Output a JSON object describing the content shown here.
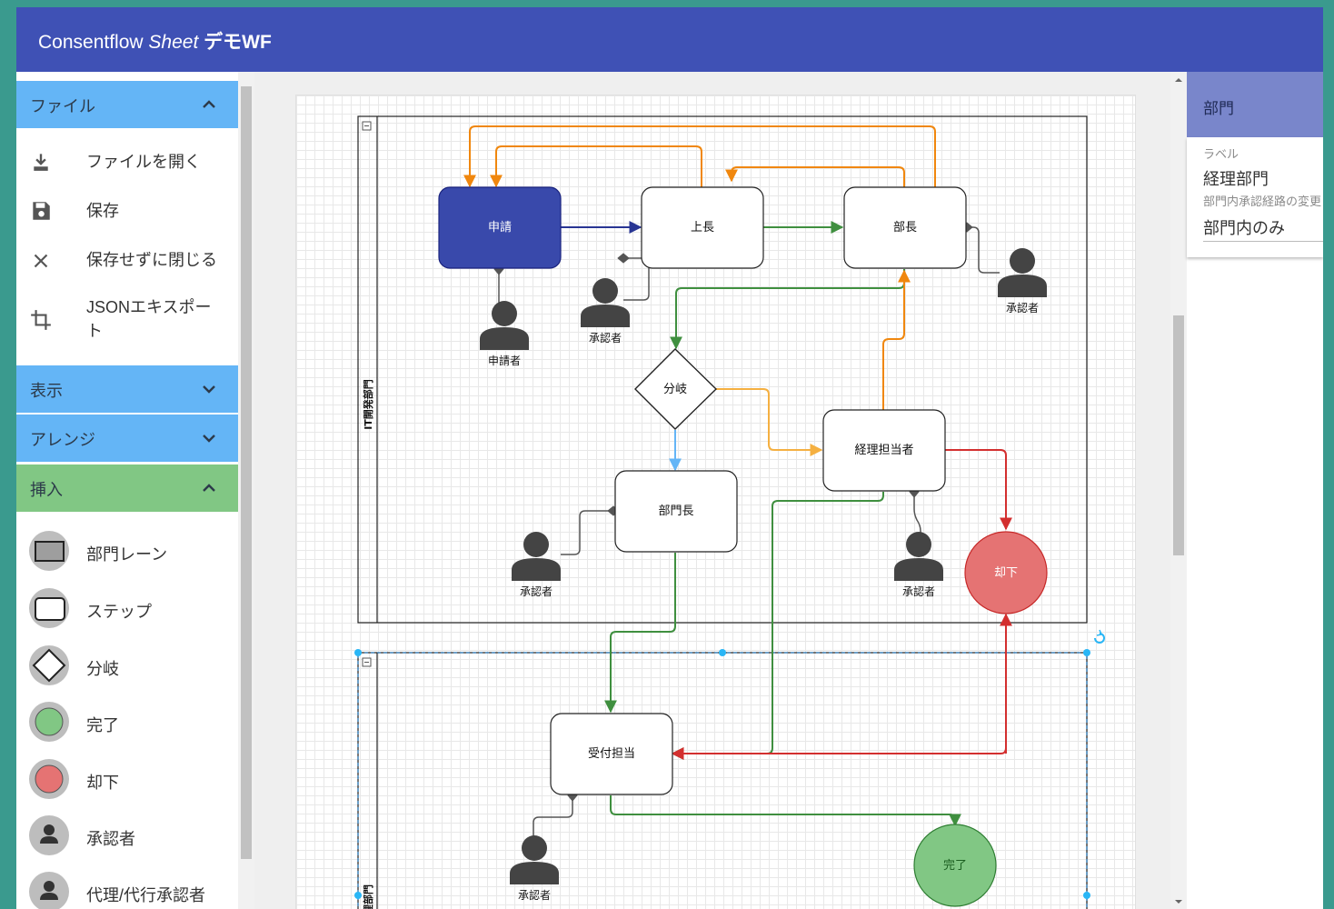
{
  "app": {
    "title_plain": "Consentflow ",
    "title_italic": "Sheet",
    "title_bold": " デモWF"
  },
  "sidebar": {
    "file_header": "ファイル",
    "file_items": [
      "ファイルを開く",
      "保存",
      "保存せずに閉じる",
      "JSONエキスポー",
      "ト"
    ],
    "view_header": "表示",
    "arrange_header": "アレンジ",
    "insert_header": "挿入",
    "insert_items": [
      "部門レーン",
      "ステップ",
      "分岐",
      "完了",
      "却下",
      "承認者",
      "代理/代行承認者"
    ]
  },
  "colors": {
    "file_header": "#64b5f6",
    "view_header": "#64b5f6",
    "insert_header": "#81c784",
    "appbar": "#3f51b5",
    "apply_node": "#3949ab",
    "reject_node": "#e57373",
    "complete_node": "#81c784",
    "edge_orange": "#f0870e",
    "edge_green": "#3f8f3f",
    "edge_red": "#d32f2f",
    "edge_blue": "#283593",
    "edge_lightblue": "#64b5f6",
    "edge_lightorange": "#f5b041"
  },
  "diagram": {
    "lane1_label": "IT開発部門",
    "lane2_label": "経理部門",
    "nodes": {
      "apply": "申請",
      "boss": "上長",
      "dept_head": "部長",
      "branch": "分岐",
      "accounting": "経理担当者",
      "section_head": "部門長",
      "reject": "却下",
      "reception": "受付担当",
      "complete": "完了"
    },
    "actors": {
      "applicant": "申請者",
      "approver": "承認者"
    }
  },
  "right_panel": {
    "header": "部門",
    "label_caption": "ラベル",
    "label_value": "経理部門",
    "route_caption": "部門内承認経路の変更",
    "route_value": "部門内のみ"
  }
}
